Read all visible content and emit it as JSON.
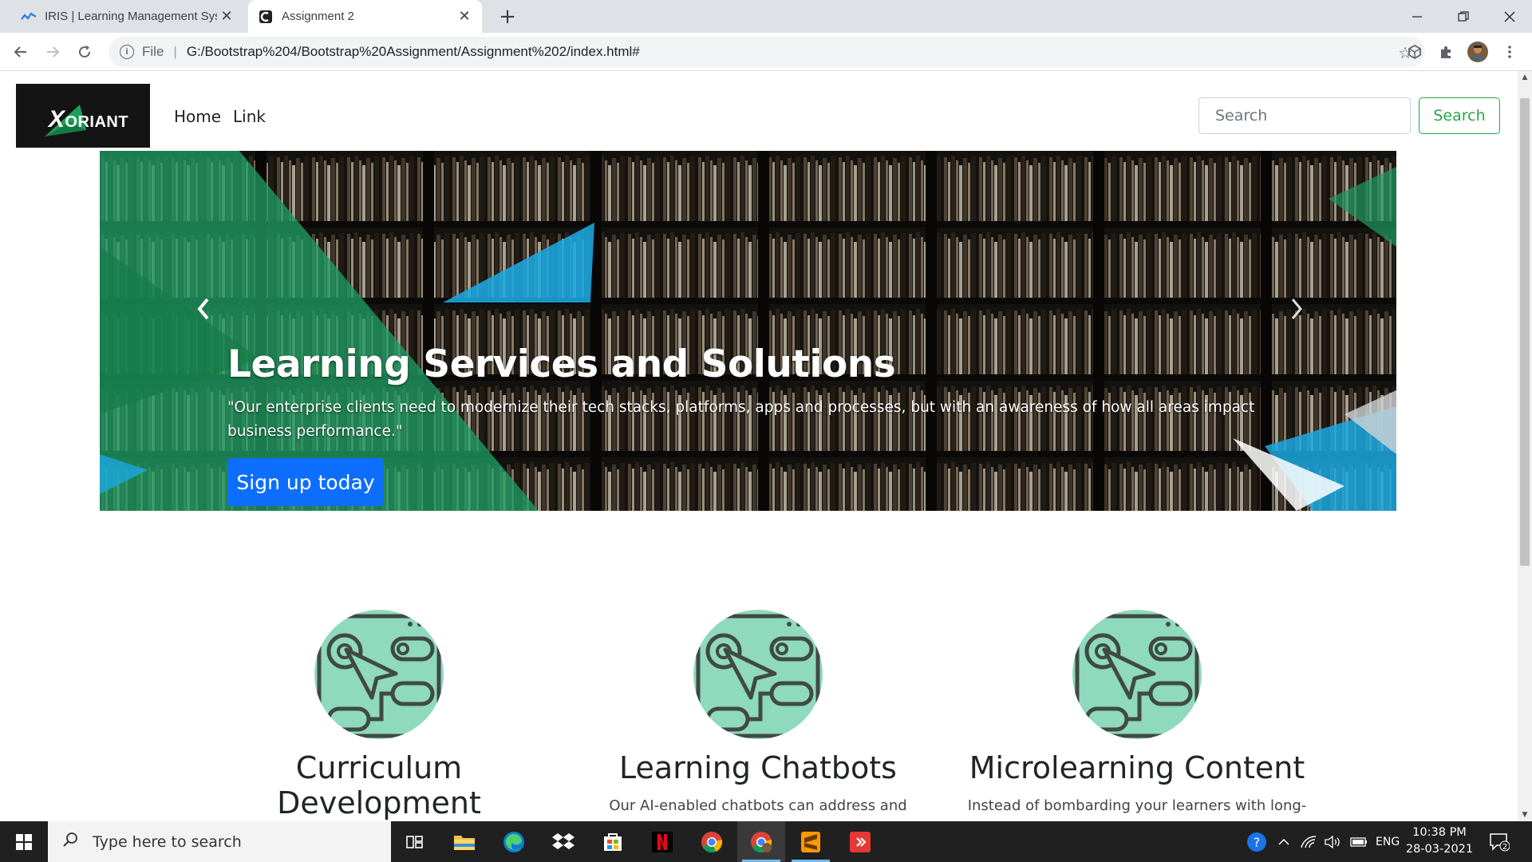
{
  "browser": {
    "tabs": [
      {
        "title": "IRIS | Learning Management Syst",
        "favicon": "iris-favicon",
        "active": false
      },
      {
        "title": "Assignment 2",
        "favicon": "codepen-favicon",
        "active": true
      }
    ],
    "url_scheme": "File",
    "url": "G:/Bootstrap%204/Bootstrap%20Assignment/Assignment%202/index.html#"
  },
  "navbar": {
    "brand": "XORIANT",
    "brand_lead": "X",
    "brand_rest": "ORIANT",
    "links": [
      "Home",
      "Link"
    ],
    "search_placeholder": "Search",
    "search_button": "Search"
  },
  "carousel": {
    "title": "Learning Services and Solutions",
    "text": "\"Our enterprise clients need to modernize their tech stacks, platforms, apps and processes, but with an awareness of how all areas impact business performance.\"",
    "cta": "Sign up today"
  },
  "features": [
    {
      "title": "Curriculum Development",
      "text": ""
    },
    {
      "title": "Learning Chatbots",
      "text": "Our AI-enabled chatbots can address and answer"
    },
    {
      "title": "Microlearning Content",
      "text": "Instead of bombarding your learners with long-"
    }
  ],
  "taskbar": {
    "search_placeholder": "Type here to search",
    "language": "ENG",
    "time": "10:38 PM",
    "date": "28-03-2021",
    "notification_count": "2"
  },
  "colors": {
    "primary": "#0d6efd",
    "success": "#28a745",
    "feature_icon_bg": "#8fd9bd",
    "logo_bg": "#141414"
  }
}
